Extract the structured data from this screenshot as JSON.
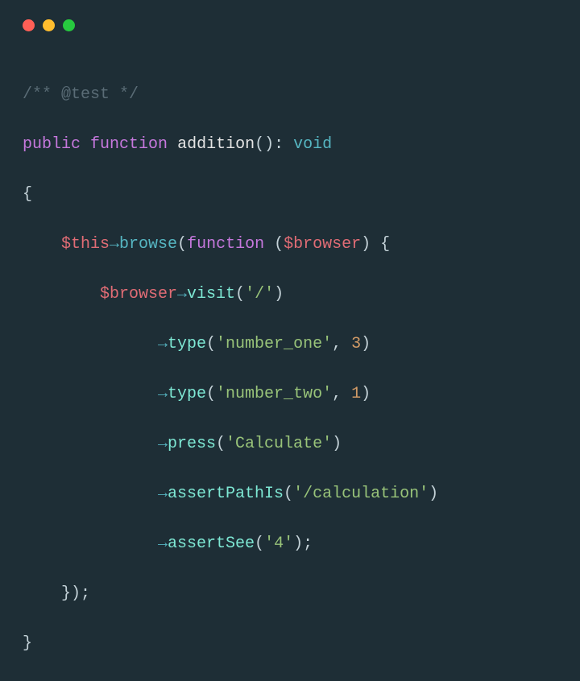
{
  "code": {
    "comment": "/** @test */",
    "kw_public": "public",
    "kw_function": "function",
    "fn_name": "addition",
    "kw_void": "void",
    "brace_open": "{",
    "brace_close": "}",
    "this": "$this",
    "browse": "browse",
    "closure_kw": "function",
    "browser": "$browser",
    "visit": "visit",
    "visit_arg": "'/'",
    "type_method": "type",
    "type1_arg1": "'number_one'",
    "type1_arg2": "3",
    "type2_arg1": "'number_two'",
    "type2_arg2": "1",
    "press": "press",
    "press_arg": "'Calculate'",
    "assertPathIs": "assertPathIs",
    "assertPathIs_arg": "'/calculation'",
    "assertSee": "assertSee",
    "assertSee_arg": "'4'",
    "closure_close": "});"
  }
}
